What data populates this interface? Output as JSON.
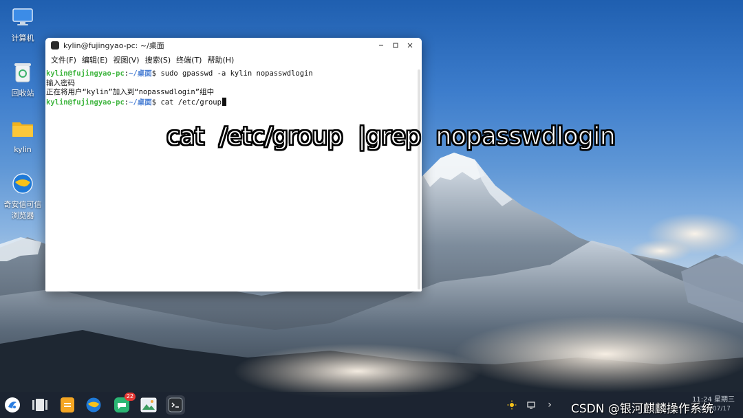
{
  "desktop": {
    "icons": [
      {
        "label": "计算机",
        "icon": "computer-icon"
      },
      {
        "label": "回收站",
        "icon": "trash-icon"
      },
      {
        "label": "kylin",
        "icon": "folder-icon"
      },
      {
        "label_line1": "奇安信可信",
        "label_line2": "浏览器",
        "icon": "browser-icon"
      }
    ]
  },
  "terminal": {
    "title": "kylin@fujingyao-pc: ~/桌面",
    "menu": [
      "文件(F)",
      "编辑(E)",
      "视图(V)",
      "搜索(S)",
      "终端(T)",
      "帮助(H)"
    ],
    "lines": [
      {
        "user": "kylin@fujingyao-pc",
        "sep": ":",
        "path": "~/桌面",
        "dollar": "$ ",
        "cmd": "sudo gpasswd -a kylin nopasswdlogin"
      },
      {
        "text": "输入密码"
      },
      {
        "text": "正在将用户“kylin”加入到“nopasswdlogin”组中"
      },
      {
        "user": "kylin@fujingyao-pc",
        "sep": ":",
        "path": "~/桌面",
        "dollar": "$ ",
        "cmd": "cat /etc/group"
      }
    ],
    "colors": {
      "user": "#3fb53f",
      "path": "#4a7fd4"
    }
  },
  "caption": "cat  /etc/group  |grep  nopasswdlogin",
  "taskbar": {
    "apps": [
      {
        "icon": "kylin-start-icon"
      },
      {
        "icon": "multitask-view-icon"
      },
      {
        "icon": "file-manager-icon"
      },
      {
        "icon": "browser-icon"
      },
      {
        "icon": "messages-icon",
        "badge": "22"
      },
      {
        "icon": "image-viewer-icon"
      },
      {
        "icon": "terminal-icon"
      }
    ],
    "tray": {
      "chevron": "›",
      "clock_time": "11:24 星期三",
      "clock_date": "2024/07/17"
    }
  },
  "watermark": "CSDN @银河麒麟操作系统"
}
